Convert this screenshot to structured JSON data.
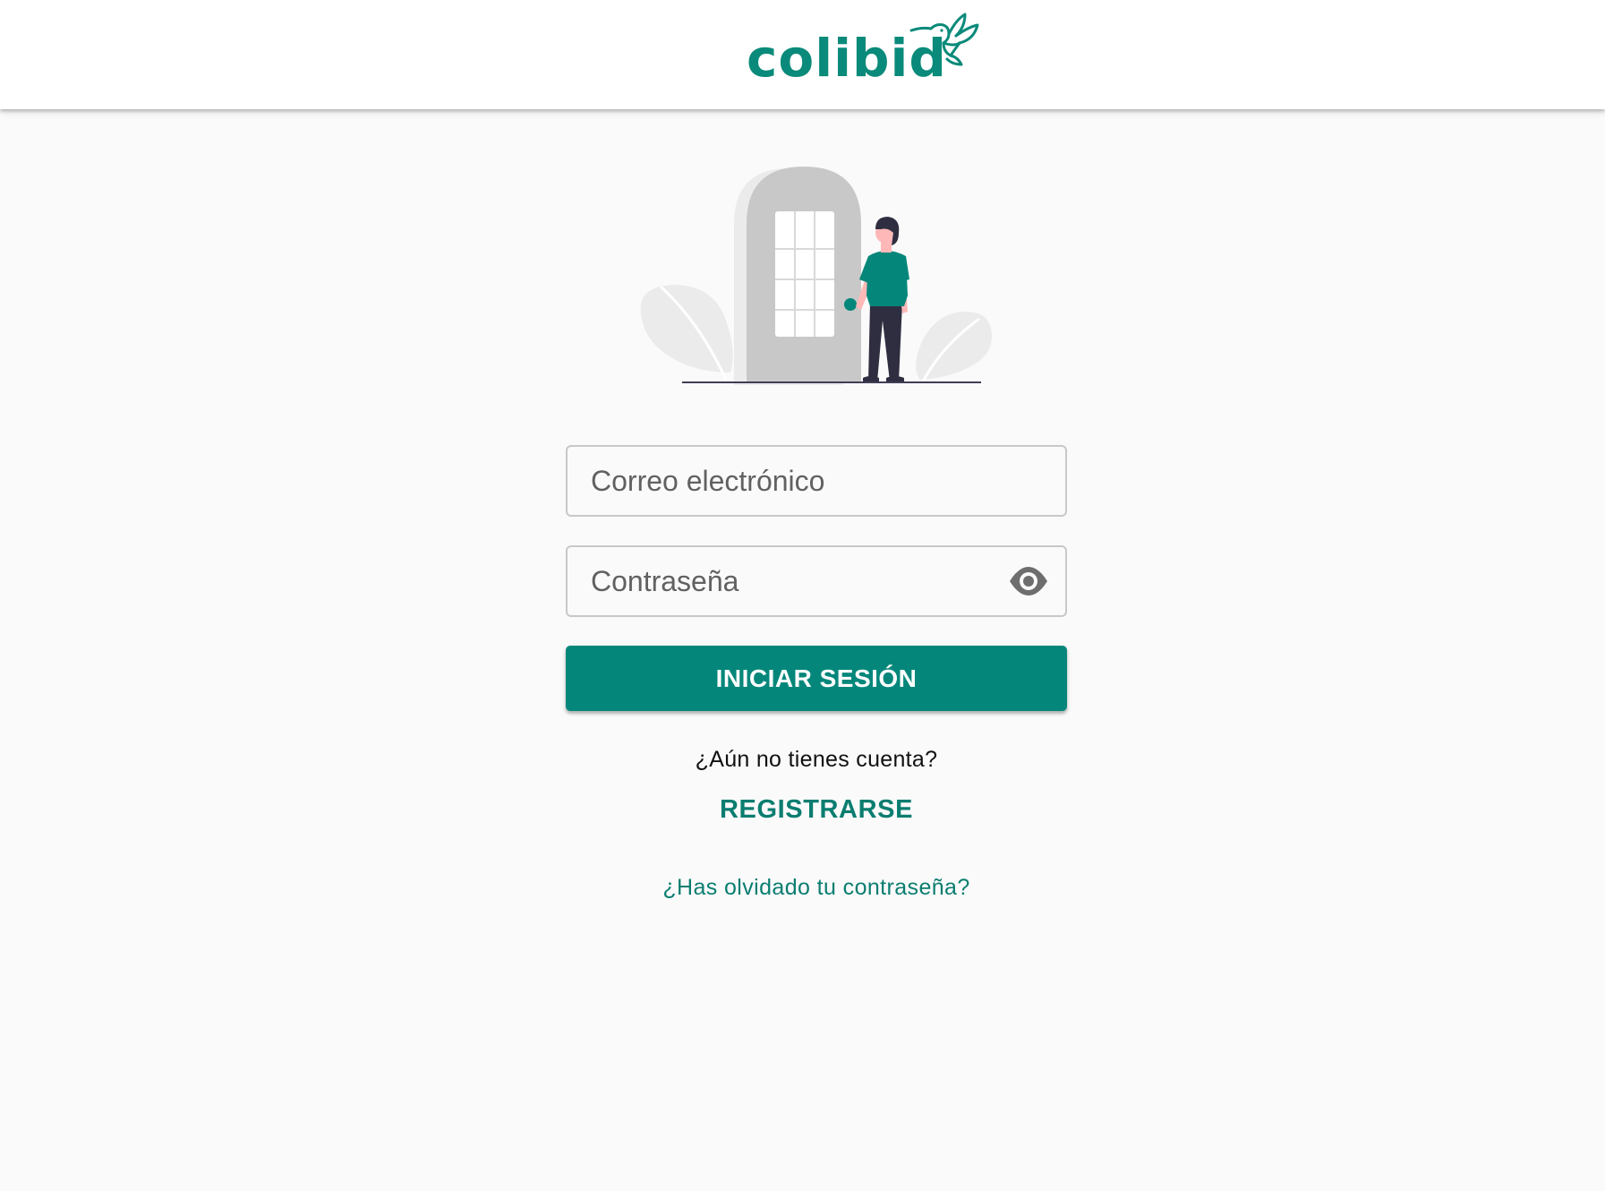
{
  "header": {
    "logo_text": "colibid",
    "logo_icon": "hummingbird-icon"
  },
  "illustration": {
    "icon": "person-at-door-illustration"
  },
  "login_form": {
    "email_placeholder": "Correo electrónico",
    "email_value": "",
    "password_placeholder": "Contraseña",
    "password_value": "",
    "toggle_visibility_icon": "eye-icon",
    "submit_label": "INICIAR SESIÓN",
    "no_account_text": "¿Aún no tienes cuenta?",
    "register_label": "REGISTRARSE",
    "forgot_password_label": "¿Has olvidado tu contraseña?"
  },
  "colors": {
    "brand": "#04877a",
    "brand_text": "#0a7d70",
    "background": "#fafafa",
    "header_bg": "#ffffff"
  }
}
